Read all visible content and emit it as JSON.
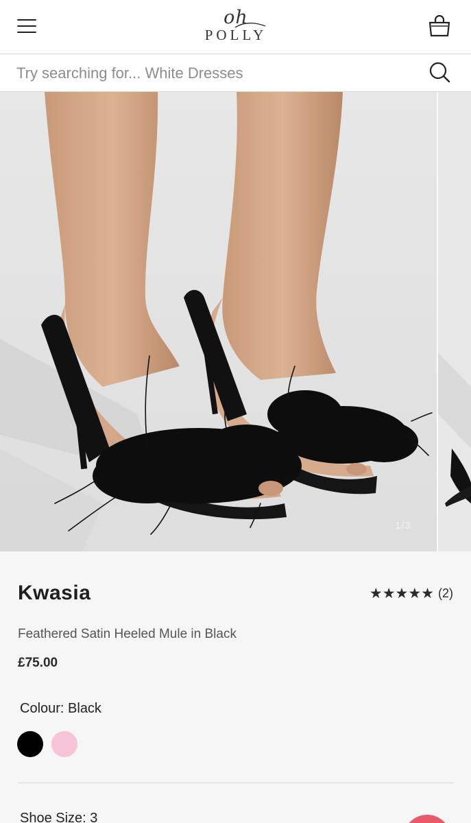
{
  "header": {
    "logo_script": "oh",
    "logo_word": "POLLY"
  },
  "search": {
    "placeholder": "Try searching for... White Dresses"
  },
  "gallery": {
    "counter": "1/3"
  },
  "product": {
    "name": "Kwasia",
    "rating_stars": 5,
    "review_count": "(2)",
    "subtitle": "Feathered Satin Heeled Mule in Black",
    "price": "£75.00",
    "colour_label": "Colour: Black",
    "swatches": [
      {
        "name": "Black",
        "hex": "#000000"
      },
      {
        "name": "Pink",
        "hex": "#f6c4d6"
      }
    ],
    "size_label": "Shoe Size: 3"
  },
  "colors": {
    "text": "#222222",
    "header_bg": "#ffffff",
    "page_bg": "#f6f6f6",
    "chat_accent": "#e85a6a"
  }
}
